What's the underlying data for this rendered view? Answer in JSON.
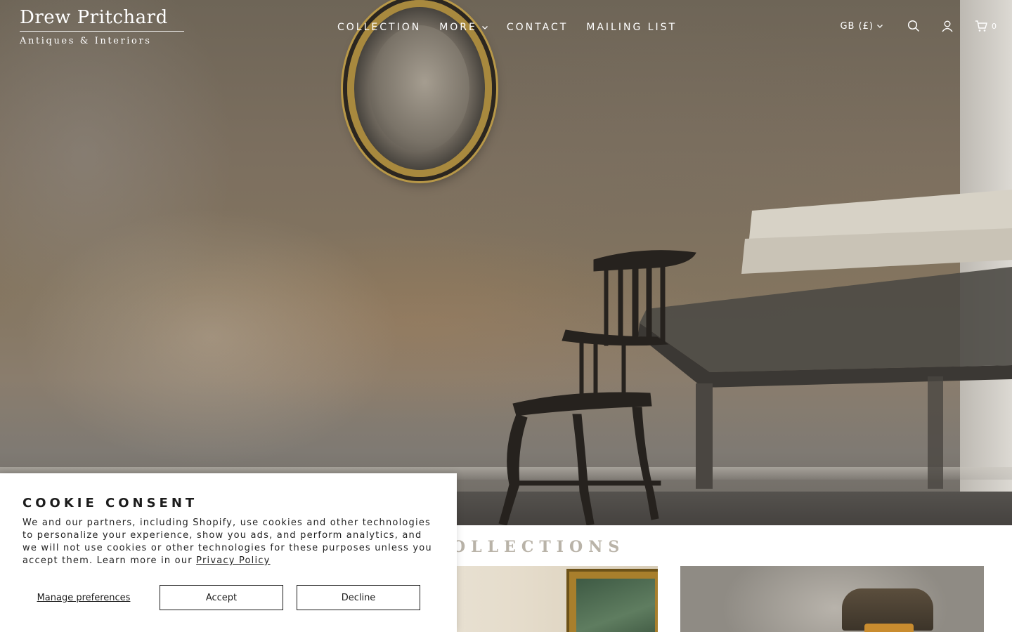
{
  "brand": {
    "name_top": "Drew Pritchard",
    "name_bottom": "Antiques & Interiors"
  },
  "nav": {
    "items": [
      {
        "label": "COLLECTION"
      },
      {
        "label": "MORE"
      },
      {
        "label": "CONTACT"
      },
      {
        "label": "MAILING LIST"
      }
    ]
  },
  "header": {
    "currency": "GB (£)",
    "cart_count": "0",
    "icons": [
      "search-icon",
      "account-icon",
      "cart-icon",
      "chevron-down-icon"
    ]
  },
  "hero": {
    "image_alt": "Windsor chair beneath an oval mirror on a distressed plaster wall"
  },
  "section": {
    "title": "ER COLLECTIONS"
  },
  "cookie": {
    "title": "COOKIE CONSENT",
    "text": "We and our partners, including Shopify, use cookies and other technologies to personalize your experience, show you ads, and perform analytics, and we will not use cookies or other technologies for these purposes unless you accept them. Learn more in our",
    "link": "Privacy Policy",
    "manage_label": "Manage preferences",
    "accept_label": "Accept",
    "decline_label": "Decline"
  },
  "colors": {
    "header_text": "#ffffff",
    "section_title": "#b9b3a8",
    "button_border": "#1c1c1c"
  }
}
